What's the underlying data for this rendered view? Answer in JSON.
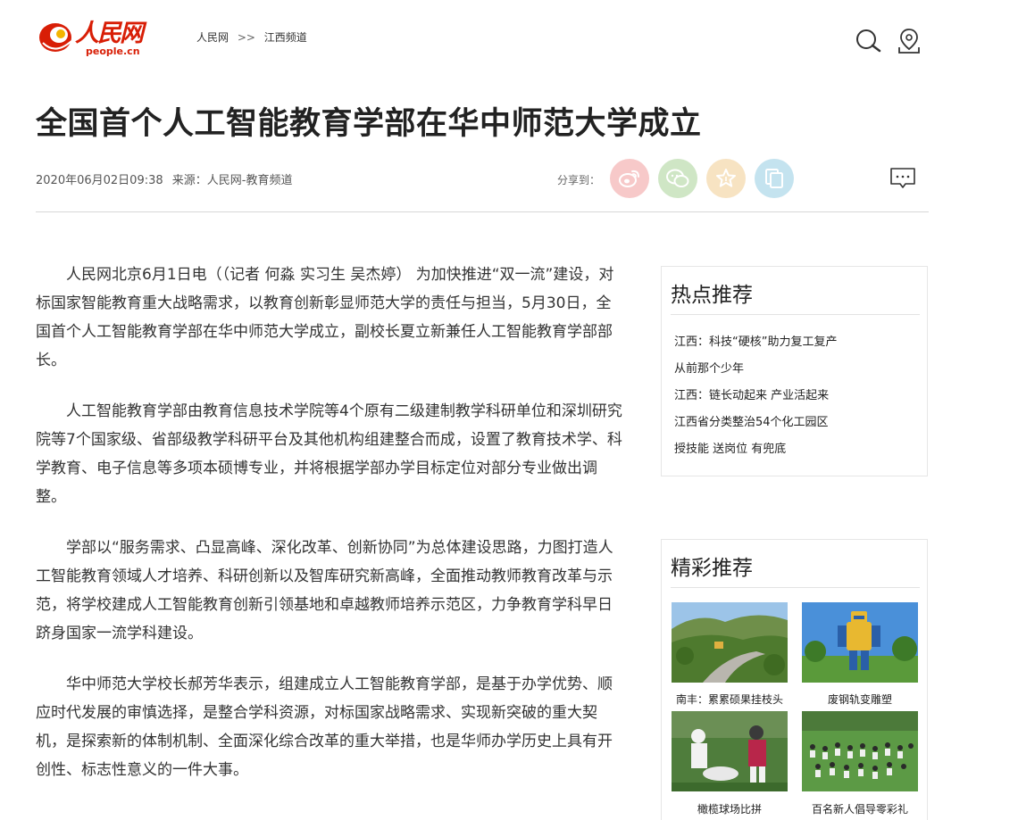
{
  "header": {
    "logo_cn": "人民网",
    "logo_en": "people.cn",
    "breadcrumb": {
      "home": "人民网",
      "sep": ">>",
      "channel": "江西频道"
    },
    "icons": [
      "search-icon",
      "location-icon"
    ]
  },
  "article": {
    "title": "全国首个人工智能教育学部在华中师范大学成立",
    "datetime": "2020年06月02日09:38",
    "source": "来源：人民网-教育频道",
    "share_label": "分享到：",
    "share_icons": [
      "weibo-icon",
      "wechat-icon",
      "favorite-icon",
      "copy-icon"
    ],
    "paragraphs": [
      "人民网北京6月1日电（（记者 何淼 实习生 吴杰婷） 为加快推进“双一流”建设，对标国家智能教育重大战略需求，以教育创新彰显师范大学的责任与担当，5月30日，全国首个人工智能教育学部在华中师范大学成立，副校长夏立新兼任人工智能教育学部部长。",
      "人工智能教育学部由教育信息技术学院等4个原有二级建制教学科研单位和深圳研究院等7个国家级、省部级教学科研平台及其他机构组建整合而成，设置了教育技术学、科学教育、电子信息等多项本硕博专业，并将根据学部办学目标定位对部分专业做出调整。",
      "学部以“服务需求、凸显高峰、深化改革、创新协同”为总体建设思路，力图打造人工智能教育领域人才培养、科研创新以及智库研究新高峰，全面推动教师教育改革与示范，将学校建成人工智能教育创新引领基地和卓越教师培养示范区，力争教育学科早日跻身国家一流学科建设。",
      "华中师范大学校长郝芳华表示，组建成立人工智能教育学部，是基于办学优势、顺应时代发展的审慎选择，是整合学科资源，对标国家战略需求、实现新突破的重大契机，是探索新的体制机制、全面深化综合改革的重大举措，也是华师办学历史上具有开创性、标志性意义的一件大事。"
    ]
  },
  "hot": {
    "title": "热点推荐",
    "items": [
      "江西：科技“硬核”助力复工复产",
      "从前那个少年",
      "江西：链长动起来 产业活起来",
      "江西省分类整治54个化工园区",
      "授技能 送岗位 有兜底"
    ]
  },
  "featured": {
    "title": "精彩推荐",
    "items": [
      {
        "caption": "南丰：累累硕果挂枝头"
      },
      {
        "caption": "废钢轨变雕塑"
      },
      {
        "caption": "橄榄球场比拼"
      },
      {
        "caption": "百名新人倡导零彩礼"
      }
    ]
  },
  "colors": {
    "brand_red": "#d81e06",
    "weibo": "#f7c9c9",
    "wechat": "#cfe6c5",
    "favorite": "#f7e3c2",
    "copy": "#c4e3ef"
  }
}
